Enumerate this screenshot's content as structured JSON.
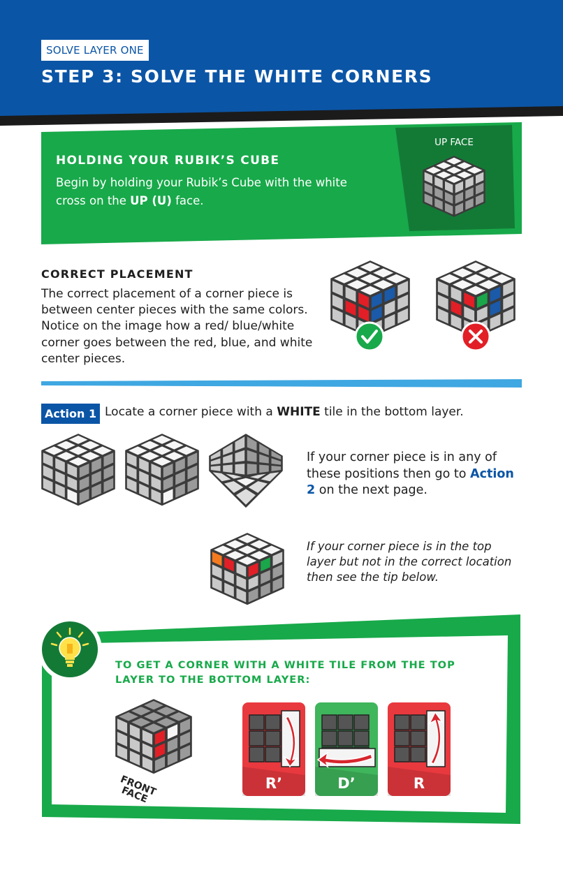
{
  "header": {
    "kicker": "SOLVE LAYER ONE",
    "title": "STEP 3: SOLVE THE WHITE CORNERS"
  },
  "holding": {
    "title": "HOLDING YOUR RUBIK’S CUBE",
    "text_before": "Begin by holding your Rubik’s Cube with the white cross on the ",
    "text_bold": "UP (U)",
    "text_after": " face.",
    "image_label": "UP FACE"
  },
  "placement": {
    "title": "CORRECT PLACEMENT",
    "text": "The correct placement of a corner piece is between center pieces with the same colors. Notice on the image how a red/ blue/white corner goes between the red, blue, and white center pieces.",
    "correct_icon": "check-icon",
    "wrong_icon": "cross-icon"
  },
  "action1": {
    "badge": "Action 1",
    "text_before": "Locate a corner piece with a ",
    "text_bold": "WHITE",
    "text_after": " tile in the bottom layer."
  },
  "positions": {
    "text_before": "If your corner piece is in any of these positions then go to ",
    "link": "Action 2",
    "text_after": " on the next page."
  },
  "top_layer_note": "If your corner piece is in the top layer but not in the correct location then see the tip below.",
  "tip": {
    "icon": "lightbulb-icon",
    "title": "TO GET A CORNER WITH A WHITE TILE FROM THE TOP LAYER TO THE BOTTOM LAYER:",
    "front_face_label": "FRONT FACE",
    "moves": [
      "R’",
      "D’",
      "R"
    ]
  },
  "colors": {
    "blue": "#0b55a6",
    "green": "#18a94a",
    "dark_green": "#137a36",
    "light_blue": "#3fa7e1",
    "cube_red": "#e21f26",
    "cube_blue": "#1a5aa8",
    "cube_green": "#1aa64a",
    "cube_orange": "#f47a20",
    "move_red": "#e8393f",
    "move_green": "#3fb55c"
  }
}
